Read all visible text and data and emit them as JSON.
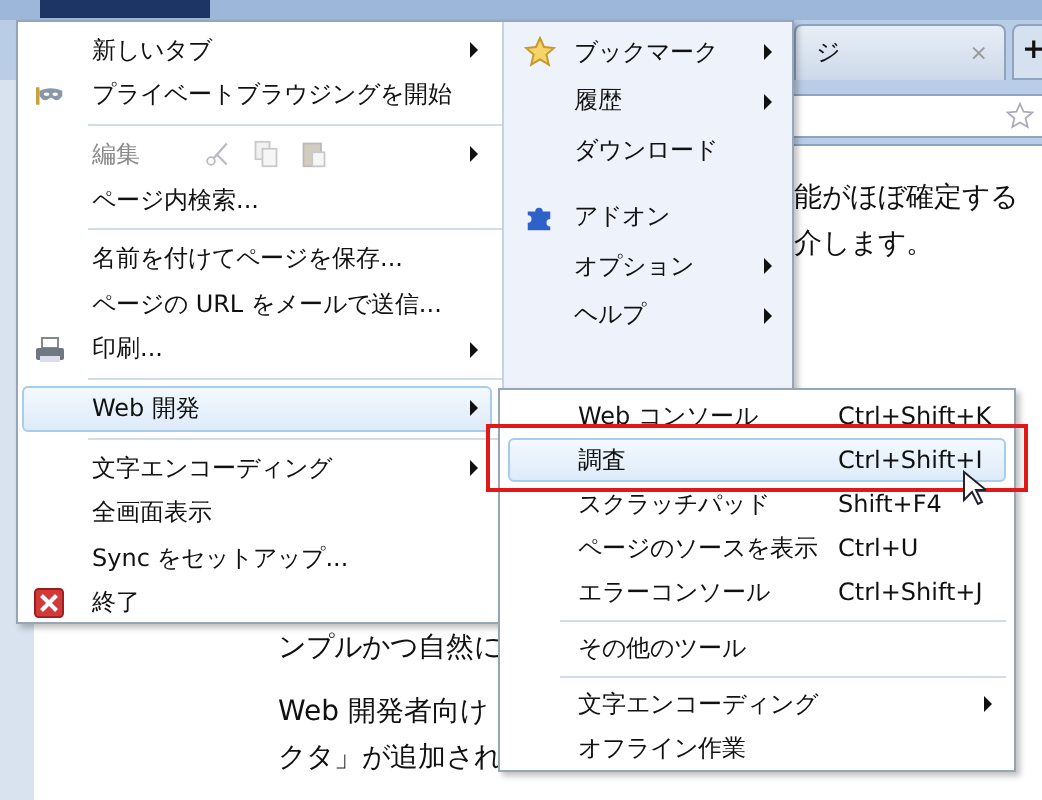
{
  "browser": {
    "tab": {
      "title": "ジ",
      "close": "×"
    },
    "new_tab": "+"
  },
  "page": {
    "right_lines": [
      "能がほぼ確定する",
      "介します。"
    ],
    "left_lines": [
      "ンプルかつ自然に",
      "Web 開発者向け",
      "クタ」が追加され"
    ]
  },
  "main_menu": {
    "left": [
      {
        "kind": "item",
        "label": "新しいタブ",
        "submenu": true,
        "disabled": false,
        "selected": false
      },
      {
        "kind": "item",
        "label": "プライベートブラウジングを開始",
        "submenu": false,
        "disabled": false,
        "selected": false
      },
      {
        "kind": "separator"
      },
      {
        "kind": "edit",
        "label": "編集",
        "submenu": true,
        "disabled": true,
        "selected": false
      },
      {
        "kind": "item",
        "label": "ページ内検索...",
        "submenu": false,
        "disabled": false,
        "selected": false
      },
      {
        "kind": "separator"
      },
      {
        "kind": "item",
        "label": "名前を付けてページを保存...",
        "submenu": false,
        "disabled": false,
        "selected": false
      },
      {
        "kind": "item",
        "label": "ページの URL をメールで送信...",
        "submenu": false,
        "disabled": false,
        "selected": false
      },
      {
        "kind": "item",
        "label": "印刷...",
        "submenu": true,
        "disabled": false,
        "selected": false
      },
      {
        "kind": "separator"
      },
      {
        "kind": "item",
        "label": "Web 開発",
        "submenu": true,
        "disabled": false,
        "selected": true
      },
      {
        "kind": "separator"
      },
      {
        "kind": "item",
        "label": "文字エンコーディング",
        "submenu": true,
        "disabled": false,
        "selected": false
      },
      {
        "kind": "item",
        "label": "全画面表示",
        "submenu": false,
        "disabled": false,
        "selected": false
      },
      {
        "kind": "item",
        "label": "Sync をセットアップ...",
        "submenu": false,
        "disabled": false,
        "selected": false
      },
      {
        "kind": "item",
        "label": "終了",
        "submenu": false,
        "disabled": false,
        "selected": false
      }
    ],
    "right": [
      {
        "kind": "item",
        "label": "ブックマーク",
        "submenu": true
      },
      {
        "kind": "item",
        "label": "履歴",
        "submenu": true
      },
      {
        "kind": "item",
        "label": "ダウンロード",
        "submenu": false
      },
      {
        "kind": "gap"
      },
      {
        "kind": "item",
        "label": "アドオン",
        "submenu": false
      },
      {
        "kind": "item",
        "label": "オプション",
        "submenu": true
      },
      {
        "kind": "item",
        "label": "ヘルプ",
        "submenu": true
      }
    ]
  },
  "web_dev_menu": [
    {
      "kind": "item",
      "label": "Web コンソール",
      "shortcut": "Ctrl+Shift+K",
      "submenu": false,
      "selected": false
    },
    {
      "kind": "item",
      "label": "調査",
      "shortcut": "Ctrl+Shift+I",
      "submenu": false,
      "selected": true
    },
    {
      "kind": "item",
      "label": "スクラッチパッド",
      "shortcut": "Shift+F4",
      "submenu": false,
      "selected": false
    },
    {
      "kind": "item",
      "label": "ページのソースを表示",
      "shortcut": "Ctrl+U",
      "submenu": false,
      "selected": false
    },
    {
      "kind": "item",
      "label": "エラーコンソール",
      "shortcut": "Ctrl+Shift+J",
      "submenu": false,
      "selected": false
    },
    {
      "kind": "separator"
    },
    {
      "kind": "item",
      "label": "その他のツール",
      "submenu": false,
      "selected": false
    },
    {
      "kind": "separator"
    },
    {
      "kind": "item",
      "label": "文字エンコーディング",
      "submenu": true,
      "selected": false
    },
    {
      "kind": "item",
      "label": "オフライン作業",
      "submenu": false,
      "selected": false
    }
  ]
}
